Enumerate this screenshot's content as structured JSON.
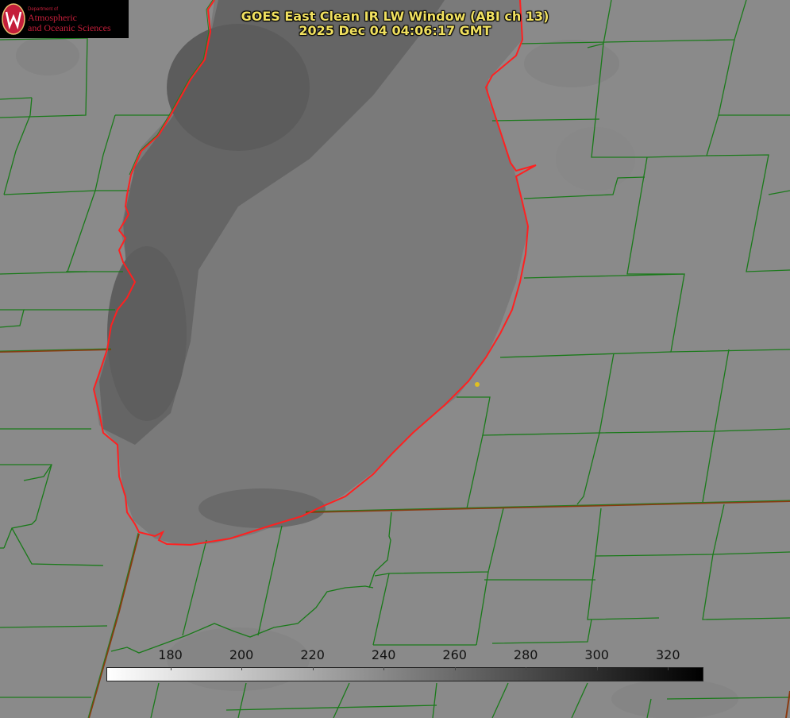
{
  "title": {
    "line1": "GOES East Clean IR LW Window (ABI ch 13)",
    "line2": "2025 Dec 04 04:06:17 GMT"
  },
  "logo": {
    "dept": "Department of",
    "line1": "Atmospheric",
    "line2": "and Oceanic Sciences",
    "colors": {
      "text": "#c41e3a",
      "seal": "#c41e3a"
    }
  },
  "colorbar": {
    "ticks": [
      "180",
      "200",
      "220",
      "240",
      "260",
      "280",
      "300",
      "320"
    ],
    "range": [
      162,
      330
    ],
    "colors": {
      "low": "#ffffff",
      "high": "#000000"
    }
  },
  "colors": {
    "county_lines": "#1a7a1a",
    "state_lines": "#8a3a10",
    "coastline": "#ff2020",
    "title": "#f0e060",
    "marker": "#e0c020"
  }
}
